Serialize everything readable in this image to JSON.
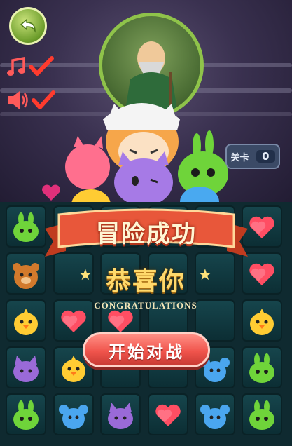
{
  "game": {
    "level": {
      "label": "关卡",
      "value": "0"
    },
    "back_button": {
      "icon": "back-arrow-icon"
    },
    "music_toggle": {
      "icon": "music-note-icon",
      "checked": true
    },
    "sound_toggle": {
      "icon": "speaker-icon",
      "checked": true
    },
    "result_popup": {
      "title": "冒险成功",
      "congrats_cn": "恭喜你",
      "congrats_en": "CONGRATULATIONS",
      "start_button_label": "开始对战"
    },
    "board": {
      "rows": [
        [
          "green-bunny",
          "empty",
          "empty",
          "empty",
          "empty",
          "heart"
        ],
        [
          "brown-bear",
          "empty",
          "empty",
          "empty",
          "empty",
          "heart"
        ],
        [
          "yellow-chick",
          "heart",
          "heart",
          "empty",
          "empty",
          "yellow-chick"
        ],
        [
          "purple-cat",
          "yellow-chick",
          "empty",
          "empty",
          "blue-mouse",
          "green-bunny"
        ],
        [
          "green-bunny",
          "blue-mouse",
          "purple-cat",
          "heart",
          "blue-mouse",
          "green-bunny"
        ]
      ]
    },
    "colors": {
      "board_bg": "#0f2a30",
      "tile": "#16454c",
      "ribbon": "#e2532f",
      "start_button": "#f0544c",
      "accent_gold": "#ffd96b"
    }
  }
}
